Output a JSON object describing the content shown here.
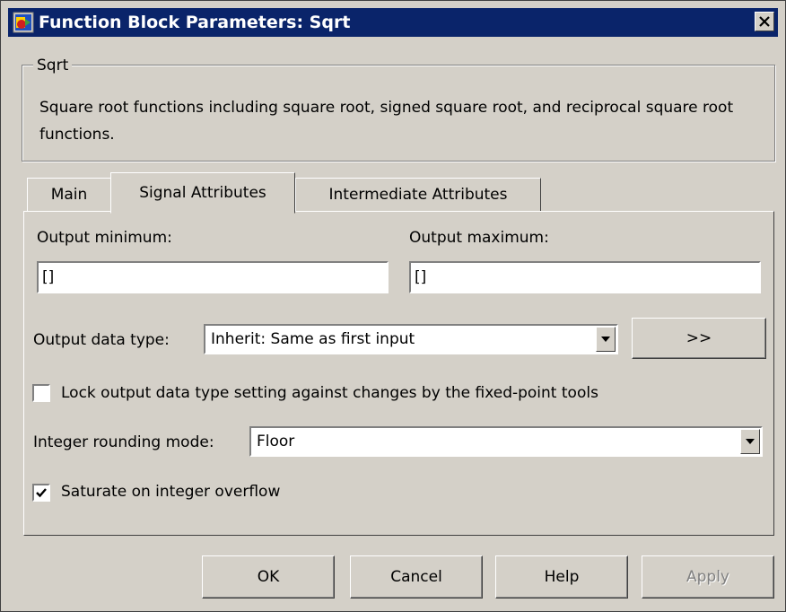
{
  "window": {
    "title": "Function Block Parameters: Sqrt"
  },
  "group": {
    "legend": "Sqrt",
    "description": "Square root functions including square root, signed square root, and reciprocal square root functions."
  },
  "tabs": [
    {
      "label": "Main",
      "active": false
    },
    {
      "label": "Signal Attributes",
      "active": true
    },
    {
      "label": "Intermediate Attributes",
      "active": false
    }
  ],
  "signal": {
    "output_min_label": "Output minimum:",
    "output_min_value": "[]",
    "output_max_label": "Output maximum:",
    "output_max_value": "[]",
    "data_type_label": "Output data type:",
    "data_type_value": "Inherit: Same as first input",
    "assistant_button": ">>",
    "lock_label": "Lock output data type setting against changes by the fixed-point tools",
    "lock_checked": false,
    "rounding_label": "Integer rounding mode:",
    "rounding_value": "Floor",
    "saturate_label": "Saturate on integer overflow",
    "saturate_checked": true
  },
  "buttons": {
    "ok": "OK",
    "cancel": "Cancel",
    "help": "Help",
    "apply": "Apply"
  },
  "colors": {
    "titlebar": "#0a246a",
    "face": "#d4d0c8"
  }
}
